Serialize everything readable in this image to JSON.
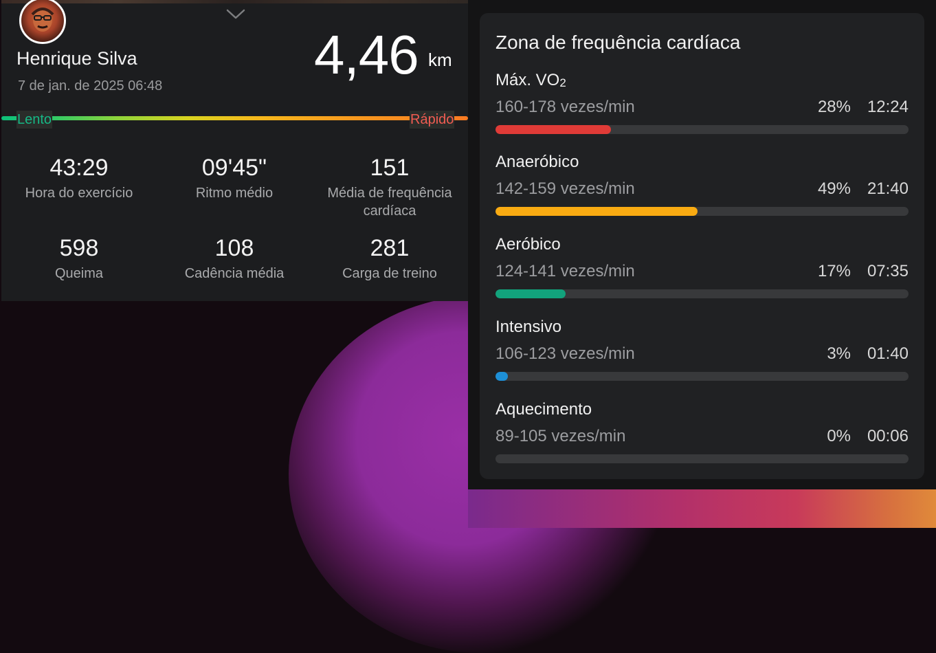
{
  "workout": {
    "user_name": "Henrique Silva",
    "date_time": "7 de jan. de 2025 06:48",
    "distance_value": "4,46",
    "distance_unit": "km",
    "pace_scale": {
      "slow_label": "Lento",
      "fast_label": "Rápido"
    },
    "stats": [
      {
        "value": "43:29",
        "label": "Hora do exercício"
      },
      {
        "value": "09'45\"",
        "label": "Ritmo médio"
      },
      {
        "value": "151",
        "label": "Média de frequência cardíaca"
      },
      {
        "value": "598",
        "label": "Queima"
      },
      {
        "value": "108",
        "label": "Cadência média"
      },
      {
        "value": "281",
        "label": "Carga de treino"
      }
    ]
  },
  "heart_rate_zones": {
    "title": "Zona de frequência cardíaca",
    "zones": [
      {
        "name": "Máx. VO",
        "name_sub": "2",
        "range": "160-178 vezes/min",
        "percent": "28%",
        "time": "12:24",
        "fill_fraction": 0.28,
        "color": "#e03b37"
      },
      {
        "name": "Anaeróbico",
        "name_sub": "",
        "range": "142-159 vezes/min",
        "percent": "49%",
        "time": "21:40",
        "fill_fraction": 0.49,
        "color": "#f9ab12"
      },
      {
        "name": "Aeróbico",
        "name_sub": "",
        "range": "124-141 vezes/min",
        "percent": "17%",
        "time": "07:35",
        "fill_fraction": 0.17,
        "color": "#12a37c"
      },
      {
        "name": "Intensivo",
        "name_sub": "",
        "range": "106-123 vezes/min",
        "percent": "3%",
        "time": "01:40",
        "fill_fraction": 0.03,
        "color": "#1d8fd6"
      },
      {
        "name": "Aquecimento",
        "name_sub": "",
        "range": "89-105 vezes/min",
        "percent": "0%",
        "time": "00:06",
        "fill_fraction": 0.0,
        "color": "#808080"
      }
    ]
  },
  "icons": {
    "collapse": "chevron-down-icon",
    "avatar": "user-avatar"
  }
}
